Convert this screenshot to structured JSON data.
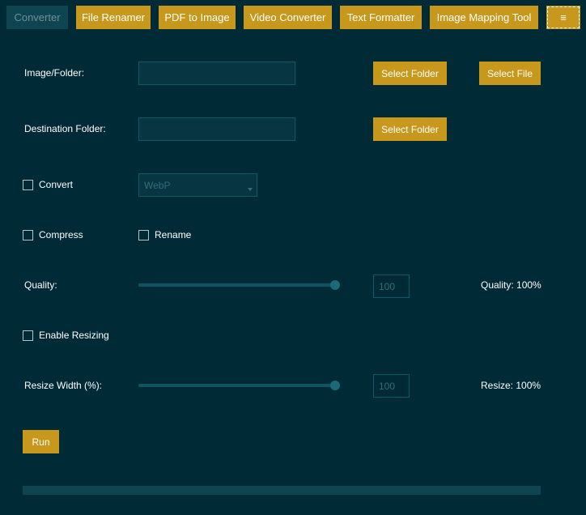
{
  "nav": {
    "items": [
      {
        "label": "Converter",
        "active": true
      },
      {
        "label": "File Renamer",
        "active": false
      },
      {
        "label": "PDF to Image",
        "active": false
      },
      {
        "label": "Video Converter",
        "active": false
      },
      {
        "label": "Text Formatter",
        "active": false
      },
      {
        "label": "Image Mapping Tool",
        "active": false
      }
    ],
    "menu_label": "≡"
  },
  "form": {
    "image_folder_label": "Image/Folder:",
    "image_folder_value": "",
    "select_folder_label": "Select Folder",
    "select_file_label": "Select File",
    "destination_label": "Destination Folder:",
    "destination_value": "",
    "destination_select_folder_label": "Select Folder",
    "convert_label": "Convert",
    "convert_checked": false,
    "format_value": "WebP",
    "compress_label": "Compress",
    "compress_checked": false,
    "rename_label": "Rename",
    "rename_checked": false,
    "quality_label": "Quality:",
    "quality_value": "100",
    "quality_fraction": 1.0,
    "quality_status": "Quality: 100%",
    "enable_resizing_label": "Enable Resizing",
    "enable_resizing_checked": false,
    "resize_width_label": "Resize Width (%):",
    "resize_value": "100",
    "resize_fraction": 1.0,
    "resize_status": "Resize: 100%",
    "run_label": "Run",
    "progress_fraction": 0
  },
  "colors": {
    "background": "#002b36",
    "accent": "#c8981c",
    "field": "#073642"
  }
}
